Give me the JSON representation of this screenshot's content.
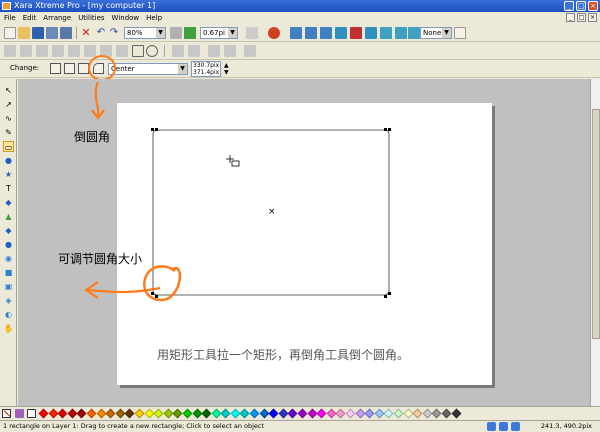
{
  "window": {
    "title": "Xara Xtreme Pro - [my computer 1]",
    "controls": [
      "_",
      "□",
      "×"
    ]
  },
  "menu": {
    "items": [
      "File",
      "Edit",
      "Arrange",
      "Utilities",
      "Window",
      "Help"
    ],
    "doc_controls": [
      "_",
      "□",
      "×"
    ]
  },
  "toolbar": {
    "zoom_value": "80%",
    "line_width": "0.67pi",
    "fill_value": "None"
  },
  "infobar": {
    "change_label": "Change:",
    "join_value": "Center",
    "width_value": "330.7pix",
    "height_value": "371.4pix"
  },
  "annotations": {
    "round_corner": "倒圆角",
    "adjust_radius": "可调节圆角大小",
    "caption": "用矩形工具拉一个矩形，再倒角工具倒个圆角。"
  },
  "status": {
    "message": "1 rectangle on Layer 1: Drag to create a new rectangle; Click to select an object",
    "coords": "241.3, 490.2pix"
  },
  "colors": {
    "annotation_orange": "#ff7b1a",
    "title_blue": "#1c4fc0"
  },
  "palette": [
    "#ff0000",
    "#ff2000",
    "#e00000",
    "#c00000",
    "#a00000",
    "#ff6600",
    "#ff8800",
    "#cc6600",
    "#996600",
    "#663300",
    "#ffcc00",
    "#ffff00",
    "#ccff00",
    "#99cc00",
    "#669900",
    "#00cc00",
    "#009900",
    "#006600",
    "#00ff99",
    "#00cccc",
    "#00ffff",
    "#00cccc",
    "#0099ff",
    "#0066cc",
    "#0000ff",
    "#3333cc",
    "#6600cc",
    "#9900cc",
    "#cc00cc",
    "#ff00ff",
    "#ff66cc",
    "#ff99cc",
    "#ffccff",
    "#cc99ff",
    "#9999ff",
    "#99ccff",
    "#ccffff",
    "#ccffcc",
    "#ffffcc",
    "#ffcc99",
    "#cccccc",
    "#999999",
    "#666666",
    "#333333"
  ]
}
